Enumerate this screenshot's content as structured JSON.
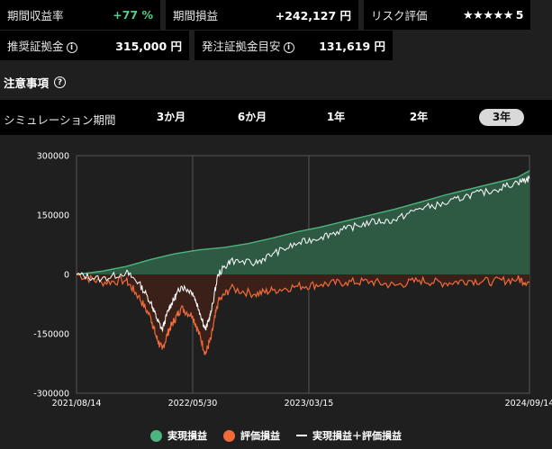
{
  "stats": {
    "return_rate": {
      "label": "期間収益率",
      "value": "+77 %"
    },
    "period_pl": {
      "label": "期間損益",
      "value": "+242,127 円"
    },
    "risk": {
      "label": "リスク評価",
      "stars": "★★★★★",
      "value": "5"
    },
    "recommended_margin": {
      "label": "推奨証拠金",
      "value": "315,000 円"
    },
    "order_margin": {
      "label": "発注証拠金目安",
      "value": "131,619 円"
    }
  },
  "notes": {
    "label": "注意事項",
    "icon": "help-circle-icon"
  },
  "period": {
    "label": "シミュレーション期間",
    "options": [
      "3か月",
      "6か月",
      "1年",
      "2年",
      "3年"
    ],
    "selected": "3年"
  },
  "legend": {
    "realized": "実現損益",
    "unrealized": "評価損益",
    "total": "実現損益＋評価損益"
  },
  "colors": {
    "realized": "#4cb580",
    "realized_fill": "#2e5a44",
    "unrealized": "#f06a3a",
    "unrealized_fill": "#3a2018",
    "total": "#ffffff"
  },
  "chart_data": {
    "type": "area",
    "x_ticks": [
      "2021/08/14",
      "2022/05/30",
      "2023/03/15",
      "2024/09/14"
    ],
    "y_ticks": [
      "300000",
      "150000",
      "0",
      "-150000",
      "-300000"
    ],
    "ylim": [
      -300000,
      300000
    ],
    "grid": true,
    "series": [
      {
        "name": "実現損益",
        "points": [
          [
            "2021/08/14",
            0
          ],
          [
            "2021/10/15",
            8000
          ],
          [
            "2021/12/15",
            20000
          ],
          [
            "2022/02/15",
            38000
          ],
          [
            "2022/04/15",
            52000
          ],
          [
            "2022/06/15",
            62000
          ],
          [
            "2022/08/15",
            68000
          ],
          [
            "2022/10/15",
            78000
          ],
          [
            "2022/12/15",
            92000
          ],
          [
            "2023/02/15",
            108000
          ],
          [
            "2023/04/15",
            120000
          ],
          [
            "2023/06/15",
            135000
          ],
          [
            "2023/08/15",
            150000
          ],
          [
            "2023/10/15",
            165000
          ],
          [
            "2023/12/15",
            182000
          ],
          [
            "2024/02/15",
            200000
          ],
          [
            "2024/04/15",
            215000
          ],
          [
            "2024/06/15",
            230000
          ],
          [
            "2024/08/15",
            245000
          ],
          [
            "2024/09/14",
            262000
          ]
        ]
      },
      {
        "name": "評価損益",
        "points": [
          [
            "2021/08/14",
            0
          ],
          [
            "2021/10/15",
            -20000
          ],
          [
            "2021/12/15",
            -15000
          ],
          [
            "2022/01/15",
            -55000
          ],
          [
            "2022/02/15",
            -110000
          ],
          [
            "2022/03/01",
            -160000
          ],
          [
            "2022/03/15",
            -190000
          ],
          [
            "2022/04/01",
            -140000
          ],
          [
            "2022/04/15",
            -115000
          ],
          [
            "2022/05/01",
            -85000
          ],
          [
            "2022/05/30",
            -105000
          ],
          [
            "2022/06/15",
            -150000
          ],
          [
            "2022/07/01",
            -200000
          ],
          [
            "2022/07/15",
            -160000
          ],
          [
            "2022/08/01",
            -70000
          ],
          [
            "2022/09/01",
            -35000
          ],
          [
            "2022/11/01",
            -50000
          ],
          [
            "2022/12/15",
            -40000
          ],
          [
            "2023/02/15",
            -30000
          ],
          [
            "2023/04/15",
            -25000
          ],
          [
            "2023/06/15",
            -20000
          ],
          [
            "2023/08/15",
            -18000
          ],
          [
            "2023/10/15",
            -28000
          ],
          [
            "2023/12/15",
            -15000
          ],
          [
            "2024/02/15",
            -22000
          ],
          [
            "2024/04/15",
            -15000
          ],
          [
            "2024/06/15",
            -18000
          ],
          [
            "2024/08/15",
            -12000
          ],
          [
            "2024/09/14",
            -20000
          ]
        ]
      },
      {
        "name": "実現損益＋評価損益",
        "points": [
          [
            "2021/08/14",
            0
          ],
          [
            "2021/10/15",
            -12000
          ],
          [
            "2021/12/15",
            5000
          ],
          [
            "2022/01/15",
            -20000
          ],
          [
            "2022/02/15",
            -70000
          ],
          [
            "2022/03/01",
            -110000
          ],
          [
            "2022/03/15",
            -140000
          ],
          [
            "2022/04/01",
            -85000
          ],
          [
            "2022/04/15",
            -60000
          ],
          [
            "2022/05/01",
            -30000
          ],
          [
            "2022/05/30",
            -45000
          ],
          [
            "2022/06/15",
            -90000
          ],
          [
            "2022/07/01",
            -140000
          ],
          [
            "2022/07/15",
            -95000
          ],
          [
            "2022/08/01",
            0
          ],
          [
            "2022/09/01",
            35000
          ],
          [
            "2022/11/01",
            28000
          ],
          [
            "2022/12/15",
            52000
          ],
          [
            "2023/02/15",
            78000
          ],
          [
            "2023/04/15",
            95000
          ],
          [
            "2023/06/15",
            115000
          ],
          [
            "2023/08/15",
            132000
          ],
          [
            "2023/10/15",
            137000
          ],
          [
            "2023/12/15",
            167000
          ],
          [
            "2024/02/15",
            178000
          ],
          [
            "2024/04/15",
            200000
          ],
          [
            "2024/06/15",
            212000
          ],
          [
            "2024/08/15",
            233000
          ],
          [
            "2024/09/14",
            242127
          ]
        ]
      }
    ]
  }
}
